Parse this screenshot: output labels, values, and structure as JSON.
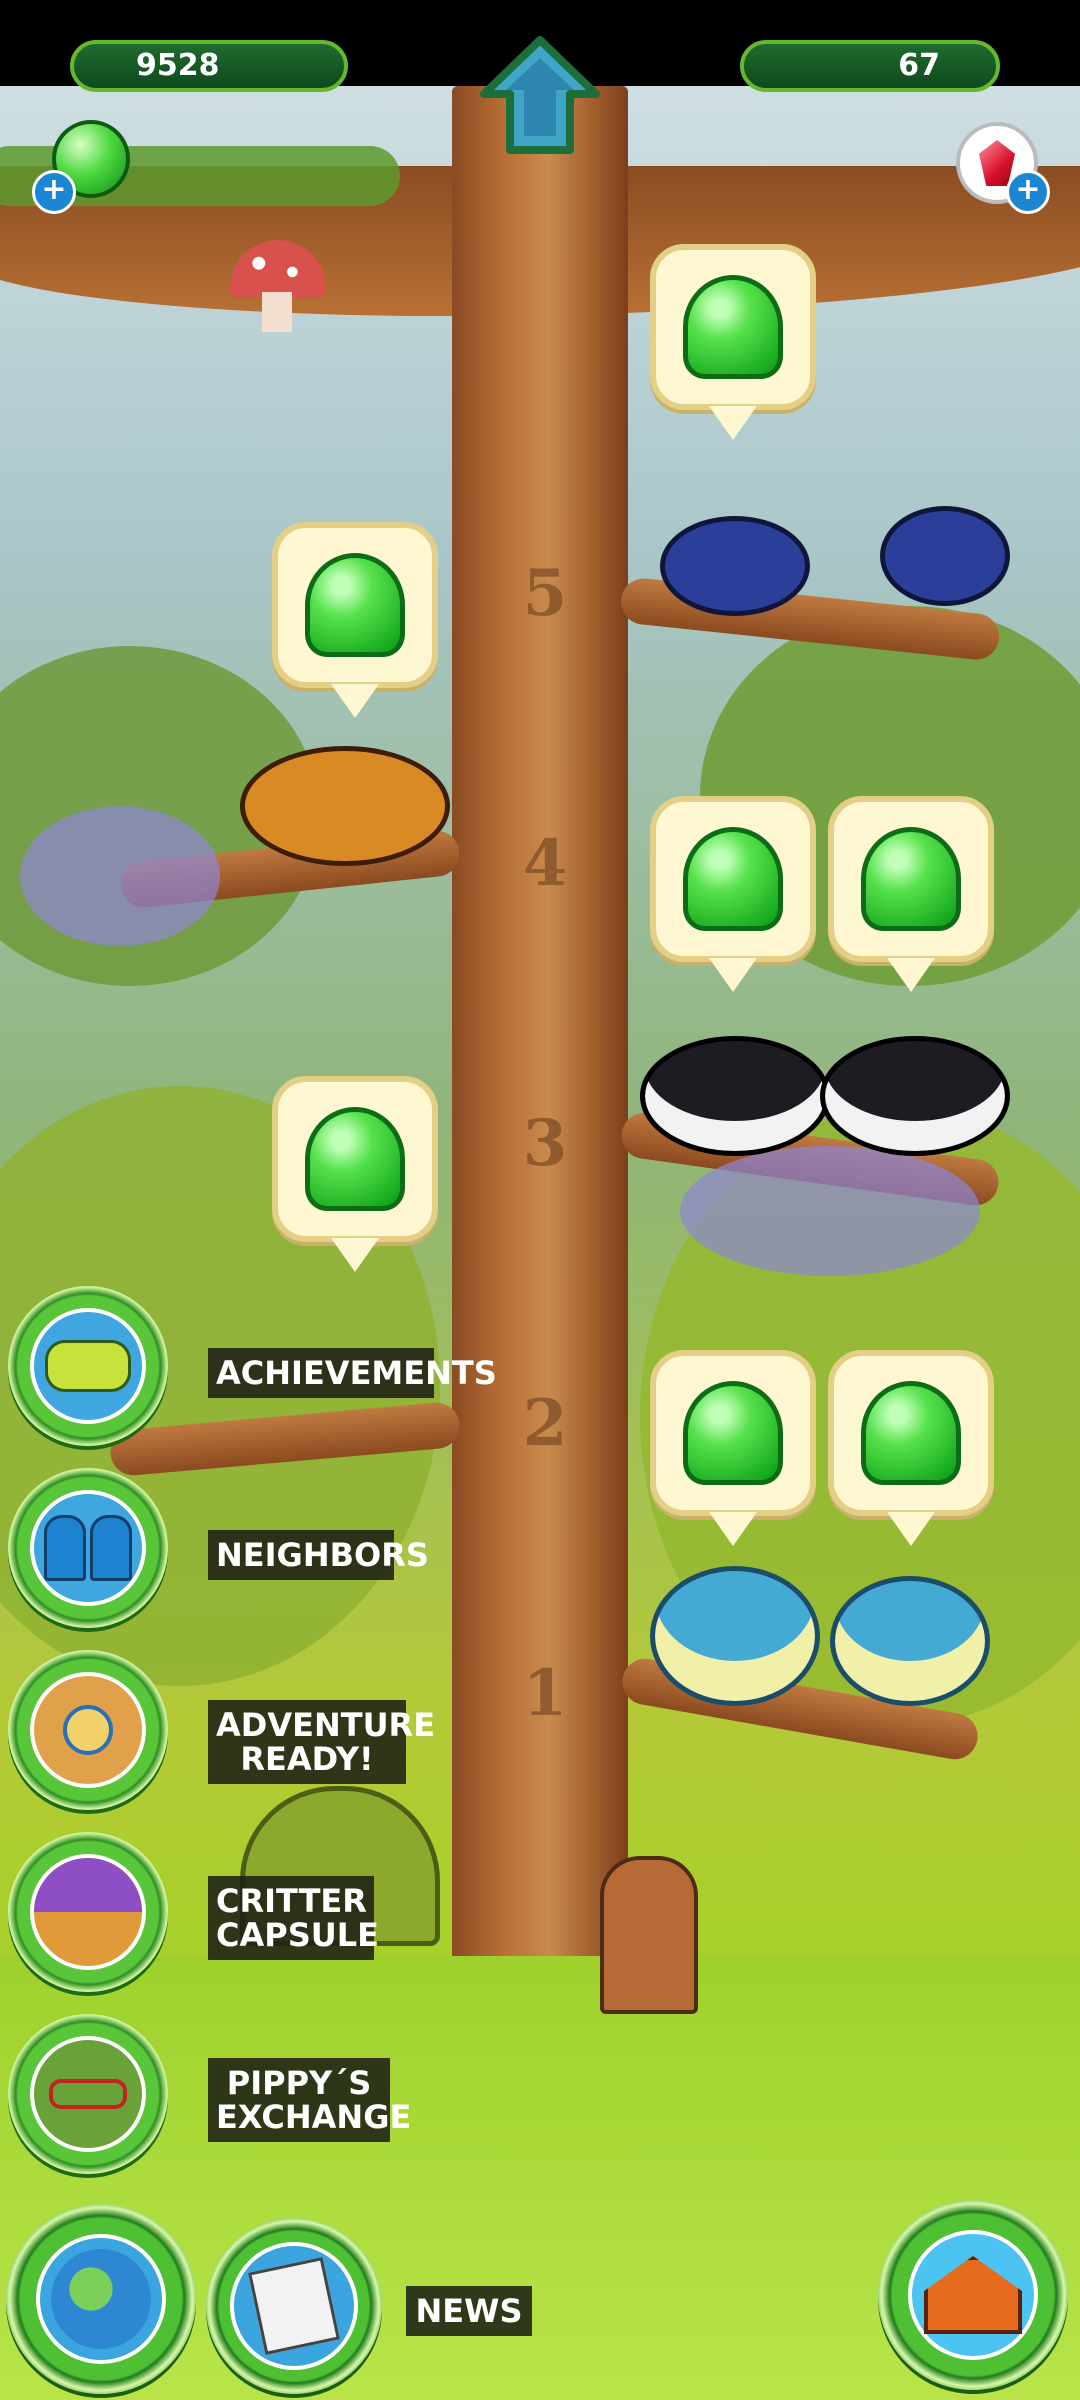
{
  "hud": {
    "jelly_count": "9528",
    "gem_count": "67",
    "add_symbol": "+"
  },
  "tree": {
    "floors": [
      "5",
      "4",
      "3",
      "2",
      "1"
    ]
  },
  "menu": {
    "achievements": "ACHIEVEMENTS",
    "neighbors": "NEIGHBORS",
    "adventure_line1": "ADVENTURE",
    "adventure_line2": "READY!",
    "capsule_line1": "CRITTER",
    "capsule_line2": "CAPSULE",
    "exchange_line1": "PIPPY´S",
    "exchange_line2": "EXCHANGE",
    "news": "NEWS"
  },
  "icons": {
    "jelly": "green-jelly-icon",
    "gem": "red-gem-icon",
    "home": "home-arrow-icon"
  },
  "colors": {
    "jelly_green": "#31c92f",
    "hud_bar": "#16562a",
    "label_bg": "#1e2014"
  }
}
